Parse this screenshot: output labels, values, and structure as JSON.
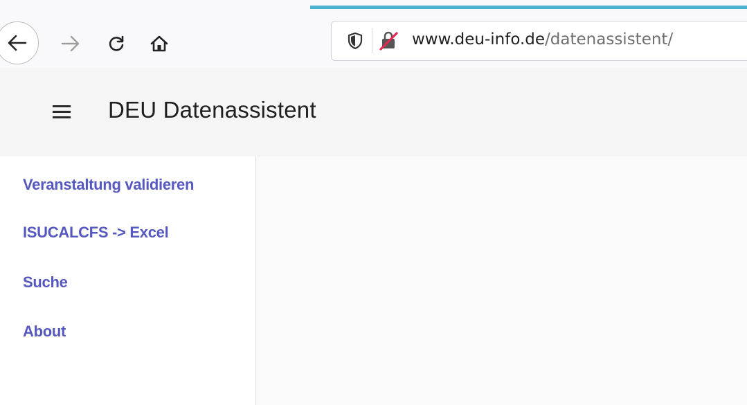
{
  "browser": {
    "url_host": "www.deu-info.de",
    "url_path": "/datenassistent/"
  },
  "app": {
    "title": "DEU Datenassistent"
  },
  "sidebar": {
    "items": [
      {
        "label": "Veranstaltung validieren"
      },
      {
        "label": "ISUCALCFS -> Excel"
      },
      {
        "label": "Suche"
      },
      {
        "label": "About"
      }
    ]
  },
  "colors": {
    "link": "#5558c0",
    "header_bg": "#f5f5f5",
    "tab_accent": "#4eb4d4"
  }
}
